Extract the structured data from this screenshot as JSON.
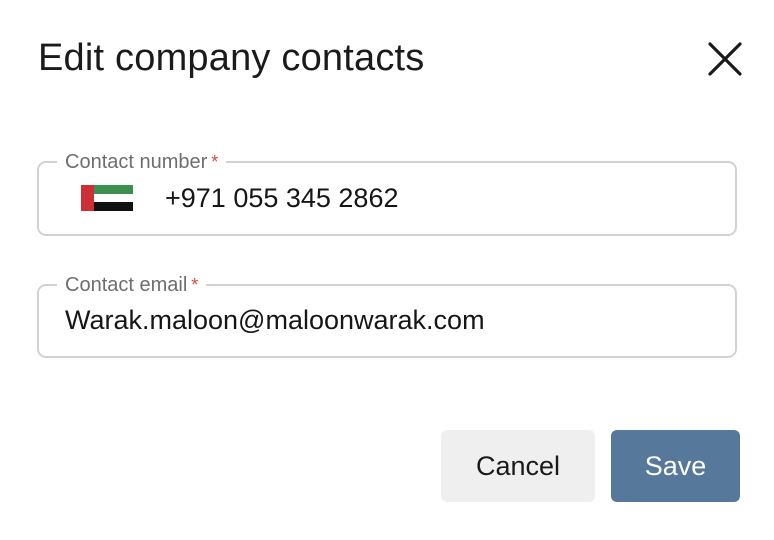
{
  "dialog": {
    "title": "Edit company contacts",
    "close_icon": "close-icon"
  },
  "fields": {
    "phone": {
      "label": "Contact number",
      "required_marker": "*",
      "country_flag": "uae-flag-icon",
      "value": "+971 055 345 2862"
    },
    "email": {
      "label": "Contact email",
      "required_marker": "*",
      "value": "Warak.maloon@maloonwarak.com"
    }
  },
  "actions": {
    "cancel_label": "Cancel",
    "save_label": "Save"
  },
  "colors": {
    "save_button": "#56789b",
    "cancel_button": "#efefef",
    "required_marker": "#d84a3a",
    "field_border": "#d2d2d2"
  }
}
